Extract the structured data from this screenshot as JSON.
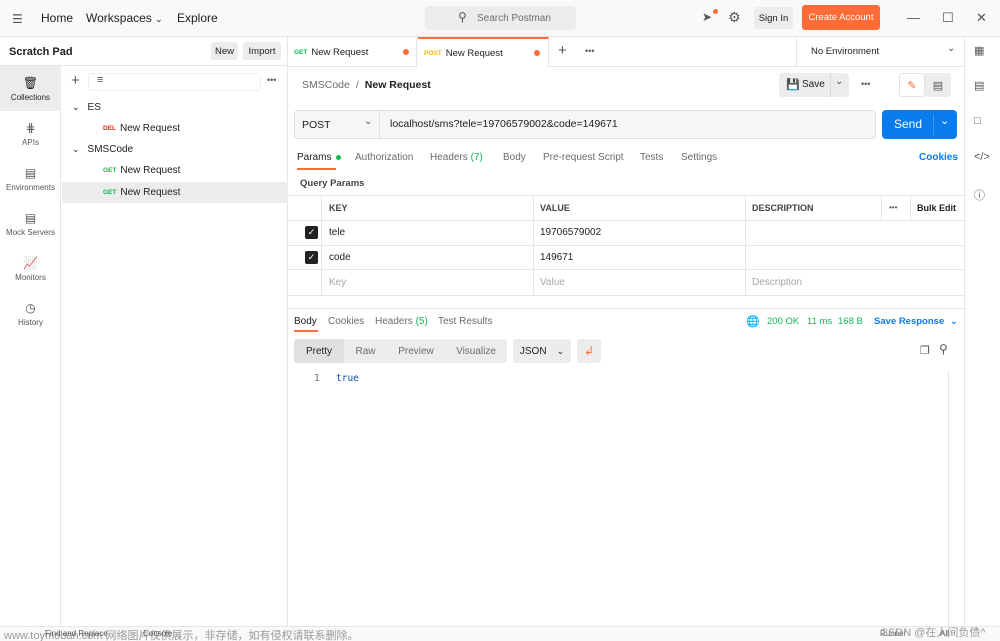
{
  "topbar": {
    "nav": [
      "Home",
      "Workspaces",
      "Explore"
    ],
    "search_placeholder": "Search Postman",
    "sign_in": "Sign In",
    "create_account": "Create Account"
  },
  "scratchpad": {
    "title": "Scratch Pad",
    "new_label": "New",
    "import_label": "Import"
  },
  "sidebar_icons": [
    {
      "label": "Collections",
      "icon": "trash-icon"
    },
    {
      "label": "APIs",
      "icon": "apis-icon"
    },
    {
      "label": "Environments",
      "icon": "environments-icon"
    },
    {
      "label": "Mock Servers",
      "icon": "mock-servers-icon"
    },
    {
      "label": "Monitors",
      "icon": "monitors-icon"
    },
    {
      "label": "History",
      "icon": "history-icon"
    }
  ],
  "tree": {
    "folders": [
      {
        "name": "ES",
        "items": [
          {
            "method": "DEL",
            "name": "New Request"
          }
        ]
      },
      {
        "name": "SMSCode",
        "items": [
          {
            "method": "GET",
            "name": "New Request"
          },
          {
            "method": "GET",
            "name": "New Request"
          }
        ]
      }
    ]
  },
  "tabs": [
    {
      "method": "GET",
      "name": "New Request"
    },
    {
      "method": "POST",
      "name": "New Request"
    }
  ],
  "environment": "No Environment",
  "breadcrumb": {
    "parent": "SMSCode",
    "sep": "/",
    "current": "New Request"
  },
  "save_label": "Save",
  "request": {
    "method": "POST",
    "url": "localhost/sms?tele=19706579002&code=149671",
    "send_label": "Send"
  },
  "request_tabs": {
    "params": "Params",
    "authorization": "Authorization",
    "headers": "Headers",
    "headers_count": "(7)",
    "body": "Body",
    "prerequest": "Pre-request Script",
    "tests": "Tests",
    "settings": "Settings",
    "cookies": "Cookies"
  },
  "query_params": {
    "title": "Query Params",
    "columns": {
      "key": "KEY",
      "value": "VALUE",
      "description": "DESCRIPTION",
      "more": "•••",
      "bulk": "Bulk Edit"
    },
    "rows": [
      {
        "key": "tele",
        "value": "19706579002"
      },
      {
        "key": "code",
        "value": "149671"
      }
    ],
    "placeholders": {
      "key": "Key",
      "value": "Value",
      "description": "Description"
    }
  },
  "response_tabs": {
    "body": "Body",
    "cookies": "Cookies",
    "headers": "Headers",
    "headers_count": "(5)",
    "test_results": "Test Results"
  },
  "response_meta": {
    "status": "200 OK",
    "time": "11 ms",
    "size": "168 B",
    "save_response": "Save Response"
  },
  "format_tabs": [
    "Pretty",
    "Raw",
    "Preview",
    "Visualize"
  ],
  "format_select": "JSON",
  "response_body": {
    "line": "1",
    "content": "true"
  },
  "statusbar": {
    "left_text": "www.toymoban.com 网络图片仅供展示，非存储，如有侵权请联系删除。",
    "find_replace": "Find and Replace",
    "console": "Console",
    "runner": "Runner",
    "all": "All",
    "watermark": "CSDN @在人间负债^"
  },
  "colors": {
    "accent": "#ff6c37",
    "send": "#097bed",
    "get": "#0cbb52",
    "post": "#ffb400",
    "del": "#eb2013",
    "status_ok": "#0cbb52",
    "save_response": "#097bed"
  }
}
